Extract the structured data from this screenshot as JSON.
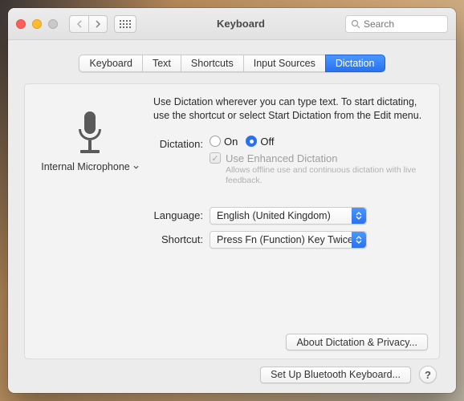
{
  "window": {
    "title": "Keyboard",
    "search_placeholder": "Search"
  },
  "tabs": [
    {
      "label": "Keyboard"
    },
    {
      "label": "Text"
    },
    {
      "label": "Shortcuts"
    },
    {
      "label": "Input Sources"
    },
    {
      "label": "Dictation",
      "active": true
    }
  ],
  "dictation": {
    "intro": "Use Dictation wherever you can type text. To start dictating, use the shortcut or select Start Dictation from the Edit menu.",
    "mic_label": "Internal Microphone",
    "radio_label": "Dictation:",
    "on_label": "On",
    "off_label": "Off",
    "selected": "Off",
    "enhanced_label": "Use Enhanced Dictation",
    "enhanced_desc": "Allows offline use and continuous dictation with live feedback.",
    "language_label": "Language:",
    "language_value": "English (United Kingdom)",
    "shortcut_label": "Shortcut:",
    "shortcut_value": "Press Fn (Function) Key Twice",
    "about_button": "About Dictation & Privacy..."
  },
  "footer": {
    "bluetooth_button": "Set Up Bluetooth Keyboard...",
    "help_label": "?"
  },
  "icons": {
    "back": "chevron-left",
    "forward": "chevron-right",
    "grid": "grid-icon",
    "search": "magnifier",
    "mic": "microphone",
    "dropdown": "chevron-up-down"
  }
}
